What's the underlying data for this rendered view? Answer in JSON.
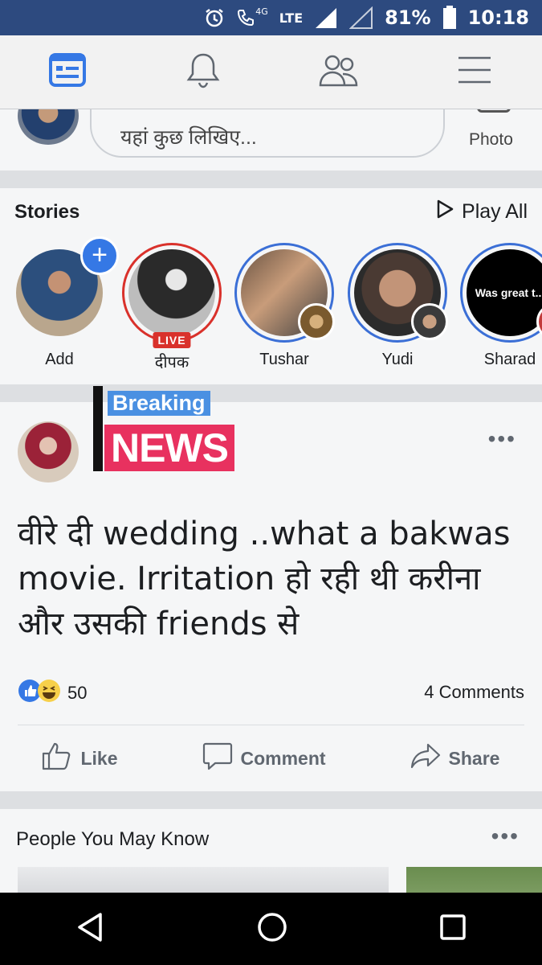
{
  "status_bar": {
    "network_badge": "4G",
    "network_type": "LTE",
    "battery": "81%",
    "time": "10:18",
    "icons": [
      "alarm-icon",
      "volte-call-icon",
      "signal-icon",
      "signal-empty-icon",
      "battery-icon"
    ]
  },
  "nav_bar": {
    "items": [
      "news-feed-icon",
      "notifications-icon",
      "friends-icon",
      "menu-icon"
    ],
    "active": "news-feed-icon",
    "accent": "#3578e5"
  },
  "composer": {
    "placeholder": "यहां कुछ लिखिए...",
    "photo_label": "Photo"
  },
  "stories": {
    "title": "Stories",
    "play_all": "Play All",
    "items": [
      {
        "name": "Add"
      },
      {
        "name": "दीपक",
        "badge": "LIVE"
      },
      {
        "name": "Tushar"
      },
      {
        "name": "Yudi"
      },
      {
        "name": "Sharad",
        "preview_text": "Was great t..."
      }
    ]
  },
  "post": {
    "overlay": {
      "line1": "Breaking",
      "line2": "NEWS"
    },
    "text": "वीरे दी wedding ..what a bakwas movie. Irritation हो रही थी करीना और उसकी friends से",
    "reaction_count": "50",
    "comments": "4 Comments",
    "actions": {
      "like": "Like",
      "comment": "Comment",
      "share": "Share"
    }
  },
  "pymk": {
    "title": "People You May Know"
  },
  "colors": {
    "status_bar": "#2d4a7f",
    "live": "#d9312b",
    "story_ring": "#3b6fd6",
    "breaking_blue": "#4a90e2",
    "news_pink": "#e8315f"
  }
}
